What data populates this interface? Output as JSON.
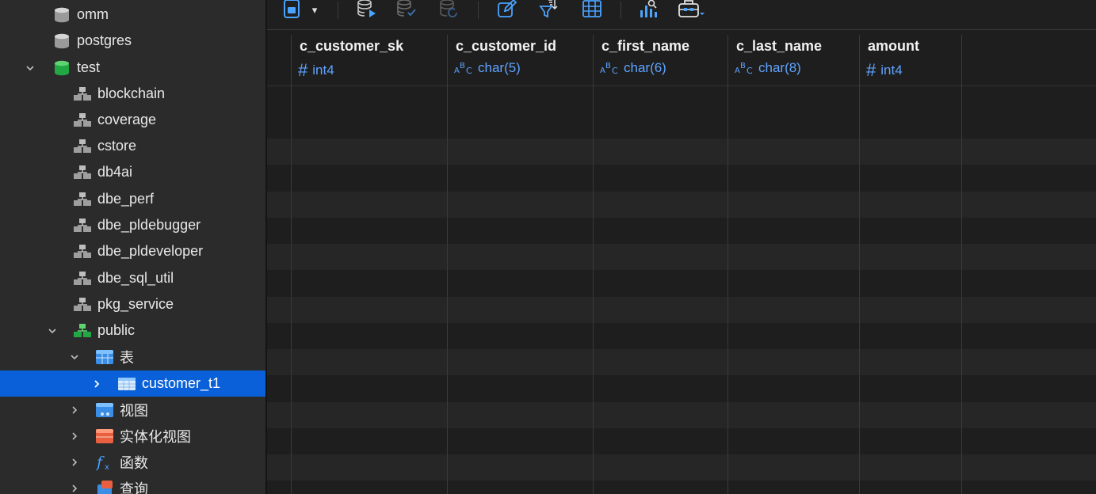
{
  "sidebar": {
    "items": [
      {
        "label": "omm",
        "icon": "database-gray-icon"
      },
      {
        "label": "postgres",
        "icon": "database-gray-icon"
      },
      {
        "label": "test",
        "icon": "database-green-icon",
        "expanded": true
      },
      {
        "label": "blockchain",
        "icon": "schema-icon"
      },
      {
        "label": "coverage",
        "icon": "schema-icon"
      },
      {
        "label": "cstore",
        "icon": "schema-icon"
      },
      {
        "label": "db4ai",
        "icon": "schema-icon"
      },
      {
        "label": "dbe_perf",
        "icon": "schema-icon"
      },
      {
        "label": "dbe_pldebugger",
        "icon": "schema-icon"
      },
      {
        "label": "dbe_pldeveloper",
        "icon": "schema-icon"
      },
      {
        "label": "dbe_sql_util",
        "icon": "schema-icon"
      },
      {
        "label": "pkg_service",
        "icon": "schema-icon"
      },
      {
        "label": "public",
        "icon": "schema-green-icon",
        "expanded": true
      },
      {
        "label": "表",
        "icon": "tables-folder-icon",
        "expanded": true
      },
      {
        "label": "customer_t1",
        "icon": "table-icon",
        "selected": true
      },
      {
        "label": "视图",
        "icon": "views-folder-icon"
      },
      {
        "label": "实体化视图",
        "icon": "materialized-views-folder-icon"
      },
      {
        "label": "函数",
        "icon": "function-icon"
      },
      {
        "label": "查询",
        "icon": "queries-folder-icon"
      }
    ]
  },
  "toolbar": {
    "dropdown_caret": "▾",
    "icons": [
      "sql-editor-icon",
      "execute-query-icon",
      "execute-check-icon",
      "refresh-query-icon",
      "edit-icon",
      "filter-sort-icon",
      "grid-view-icon",
      "chart-search-icon",
      "toolbox-icon"
    ]
  },
  "grid": {
    "columns": [
      {
        "name": "c_customer_sk",
        "type": "int4",
        "kind": "numeric"
      },
      {
        "name": "c_customer_id",
        "type": "char(5)",
        "kind": "text"
      },
      {
        "name": "c_first_name",
        "type": "char(6)",
        "kind": "text"
      },
      {
        "name": "c_last_name",
        "type": "char(8)",
        "kind": "text"
      },
      {
        "name": "amount",
        "type": "int4",
        "kind": "numeric"
      }
    ],
    "numeric_glyph": "#"
  },
  "colors": {
    "selection": "#0a60d8",
    "accent": "#5ea3ff",
    "sidebar_bg": "#2b2b2b",
    "grid_bg": "#1e1e1e"
  }
}
